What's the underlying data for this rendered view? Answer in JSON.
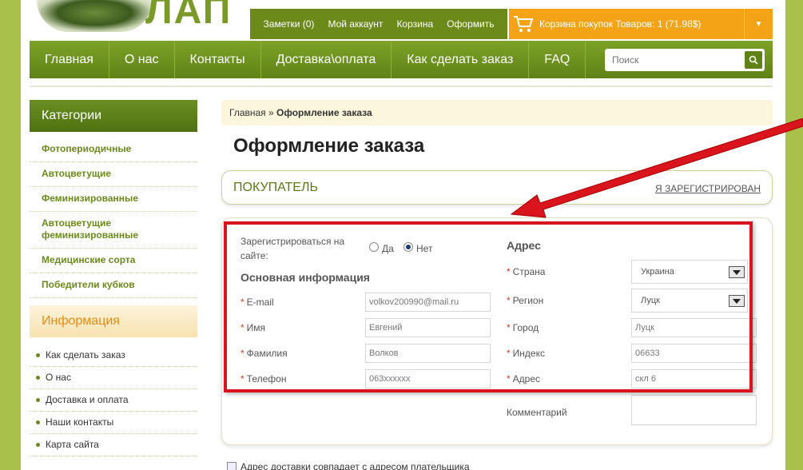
{
  "brand": {
    "logo_text": "ЛАП"
  },
  "top_links": [
    "Заметки (0)",
    "Мой аккаунт",
    "Корзина",
    "Оформить"
  ],
  "cart": {
    "label": "Корзина покупок  Товаров: 1 (71.98$)"
  },
  "nav": {
    "items": [
      "Главная",
      "О нас",
      "Контакты",
      "Доставка\\оплата",
      "Как сделать заказ",
      "FAQ"
    ]
  },
  "search": {
    "placeholder": "Поиск"
  },
  "sidebar": {
    "categories_title": "Категории",
    "categories": [
      "Фотопериодичные",
      "Автоцветущие",
      "Феминизированные",
      "Автоцветущие феминизированные",
      "Медицинские сорта",
      "Победители кубков"
    ],
    "info_title": "Информация",
    "info_items": [
      "Как сделать заказ",
      "О нас",
      "Доставка и оплата",
      "Наши контакты",
      "Карта сайта"
    ]
  },
  "breadcrumb": {
    "home": "Главная",
    "sep": " » ",
    "current": "Оформление заказа"
  },
  "page_title": "Оформление заказа",
  "buyer": {
    "title": "ПОКУПАТЕЛЬ",
    "registered_link": "Я ЗАРЕГИСТРИРОВАН"
  },
  "form": {
    "register_label": "Зарегистрироваться на сайте:",
    "yes": "Да",
    "no": "Нет",
    "selected": "Нет",
    "basic_title": "Основная информация",
    "address_title": "Адрес",
    "email_label": "E-mail",
    "email_value": "volkov200990@mail.ru",
    "name_label": "Имя",
    "name_value": "Евгений",
    "surname_label": "Фамилия",
    "surname_value": "Волков",
    "phone_label": "Телефон",
    "phone_value": "063xxxxxx",
    "country_label": "Страна",
    "country_value": "Украина",
    "region_label": "Регион",
    "region_value": "Луцк",
    "city_label": "Город",
    "city_value": "Луцк",
    "index_label": "Индекс",
    "index_value": "06633",
    "address_label": "Адрес",
    "address_value": "скл 6",
    "comment_label": "Комментарий"
  },
  "bottom": {
    "text": "Адрес доставки совпадает с адресом плательщика"
  },
  "colors": {
    "accent_green": "#6c8a1a",
    "cart_orange": "#f5a316",
    "highlight_red": "#d9141c"
  }
}
